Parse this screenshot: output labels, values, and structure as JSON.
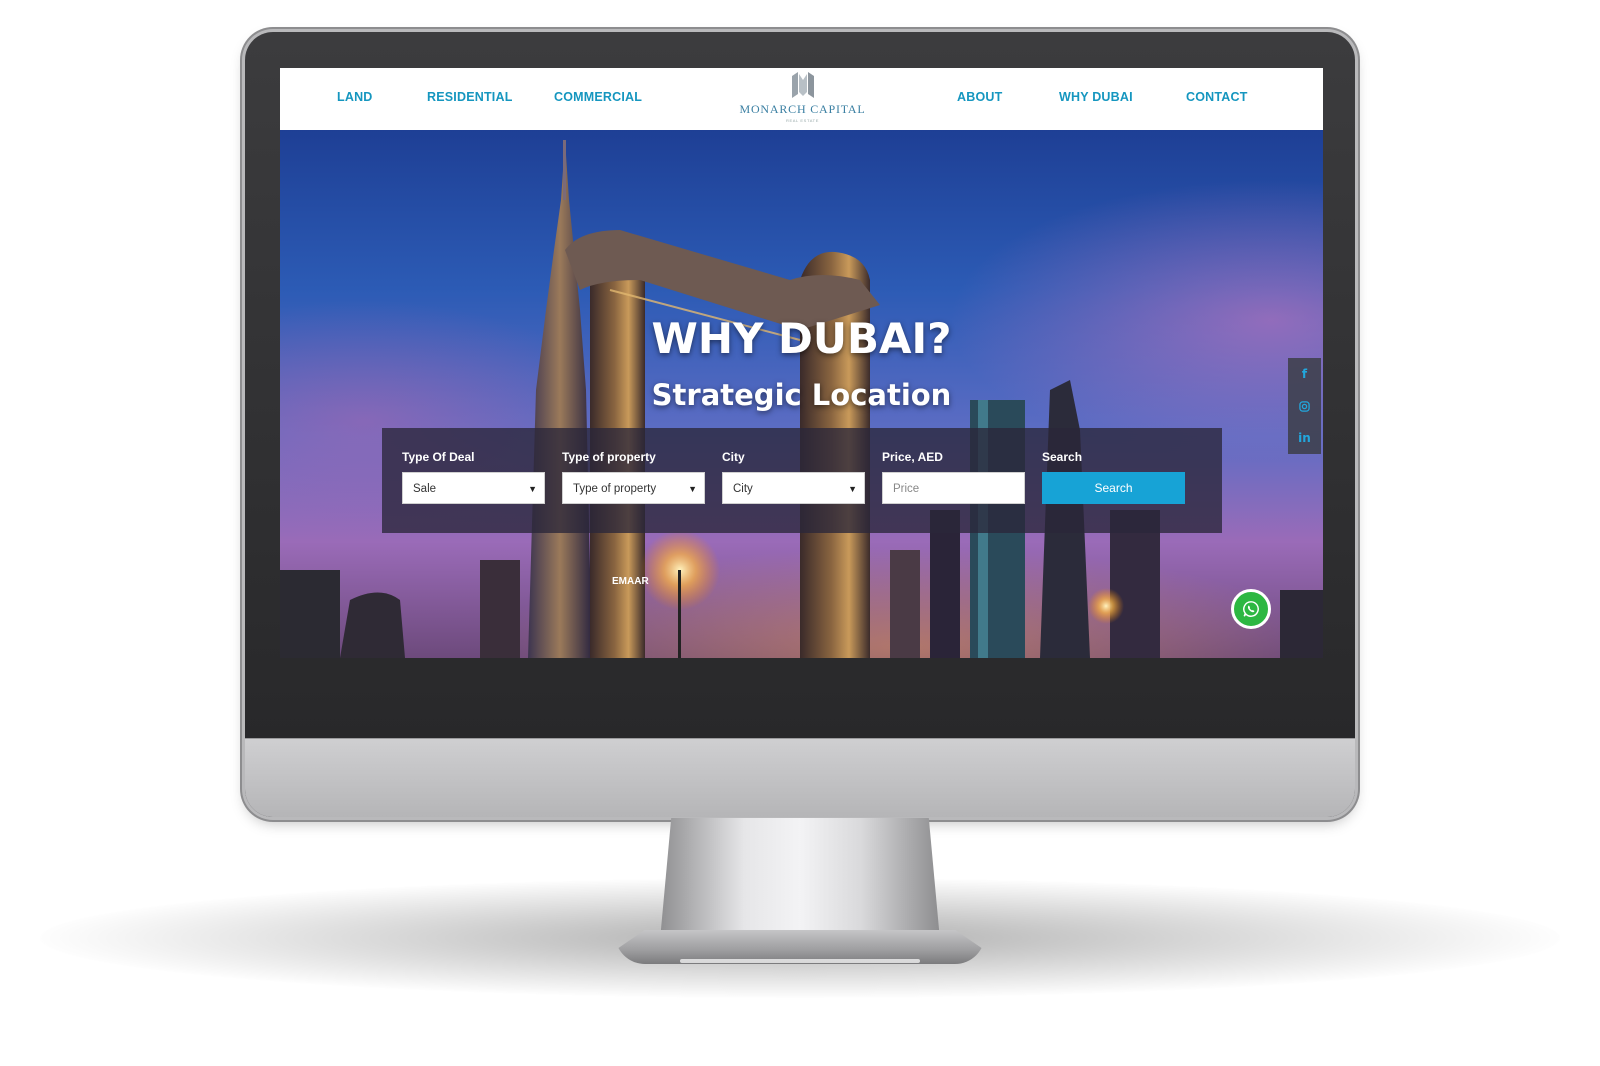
{
  "nav": {
    "left": [
      "LAND",
      "RESIDENTIAL",
      "COMMERCIAL"
    ],
    "right": [
      "ABOUT",
      "WHY DUBAI",
      "CONTACT"
    ]
  },
  "logo": {
    "name": "MONARCH CAPITAL",
    "tagline": "REAL ESTATE"
  },
  "hero": {
    "title": "WHY DUBAI?",
    "subtitle": "Strategic Location",
    "sign": "EMAAR"
  },
  "search": {
    "deal_label": "Type Of Deal",
    "deal_value": "Sale",
    "property_label": "Type of property",
    "property_value": "Type of property",
    "city_label": "City",
    "city_value": "City",
    "price_label": "Price, AED",
    "price_placeholder": "Price",
    "search_label": "Search",
    "search_button": "Search"
  },
  "social": [
    "facebook-icon",
    "instagram-icon",
    "linkedin-icon"
  ],
  "colors": {
    "accent": "#17a3d6",
    "nav_text": "#1596bf",
    "whatsapp": "#2db742"
  }
}
